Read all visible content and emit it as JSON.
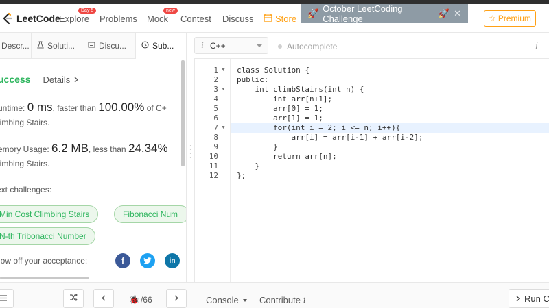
{
  "nav": {
    "logo": "LeetCode",
    "items": [
      {
        "label": "Explore",
        "badge": "Day 5"
      },
      {
        "label": "Problems"
      },
      {
        "label": "Mock",
        "badge": "new"
      },
      {
        "label": "Contest"
      },
      {
        "label": "Discuss"
      },
      {
        "label": "Store"
      }
    ],
    "banner": "October LeetCoding Challenge",
    "premium": "Premium"
  },
  "tabs": [
    "Descr...",
    "Soluti...",
    "Discu...",
    "Sub..."
  ],
  "result": {
    "status": "uccess",
    "details": "Details",
    "runtime_label": "untime:",
    "runtime_value": "0 ms",
    "runtime_cmp": ", faster than",
    "runtime_pct": "100.00%",
    "runtime_tail": "of C+",
    "runtime_line2": "limbing Stairs.",
    "memory_label": "emory Usage:",
    "memory_value": "6.2 MB",
    "memory_cmp": ", less than",
    "memory_pct": "24.34%",
    "memory_line2": "limbing Stairs.",
    "next_label": "ext challenges:",
    "challenges": [
      "Min Cost Climbing Stairs",
      "Fibonacci Num",
      "N-th Tribonacci Number"
    ],
    "share_label": "how off your acceptance:",
    "social": {
      "facebook": "f",
      "twitter": "t",
      "linkedin": "in"
    }
  },
  "editor": {
    "language": "C++",
    "autocomplete": "Autocomplete",
    "code": [
      "class Solution {",
      "public:",
      "    int climbStairs(int n) {",
      "        int arr[n+1];",
      "        arr[0] = 1;",
      "        arr[1] = 1;",
      "        for(int i = 2; i <= n; i++){",
      "            arr[i] = arr[i-1] + arr[i-2];",
      "        }",
      "        return arr[n];",
      "    }",
      "};"
    ],
    "line_numbers": [
      "1",
      "2",
      "3",
      "4",
      "5",
      "6",
      "7",
      "8",
      "9",
      "10",
      "11",
      "12"
    ]
  },
  "bottom": {
    "page": "/66",
    "console": "Console",
    "contribute": "Contribute",
    "run": "Run Co"
  }
}
